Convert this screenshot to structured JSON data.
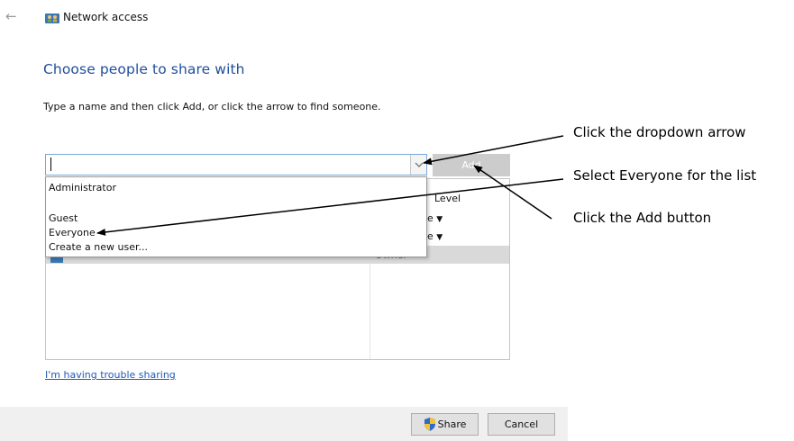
{
  "window": {
    "title": "Network access",
    "back_icon": "back-arrow-icon"
  },
  "page": {
    "title": "Choose people to share with",
    "instruction": "Type a name and then click Add, or click the arrow to find someone."
  },
  "name_input": {
    "value": "",
    "placeholder": ""
  },
  "add_button": {
    "label": "Add"
  },
  "dropdown": {
    "items": [
      "Administrator",
      "Guest",
      "Everyone",
      "Create a new user..."
    ]
  },
  "people_list": {
    "permission_header": "Level",
    "rows": [
      {
        "permission": "e"
      },
      {
        "permission": "e"
      },
      {
        "permission": "Owner"
      }
    ]
  },
  "trouble_link": "I'm having trouble sharing",
  "footer": {
    "share_label": "Share",
    "cancel_label": "Cancel"
  },
  "annotations": {
    "dropdown_arrow": "Click the dropdown arrow",
    "select_everyone": "Select Everyone for the list",
    "add_button": "Click the Add button"
  },
  "colors": {
    "title_blue": "#1f4e9c",
    "link_blue": "#1f5ab4",
    "add_disabled": "#cccccc",
    "input_border": "#7aa7d8"
  }
}
